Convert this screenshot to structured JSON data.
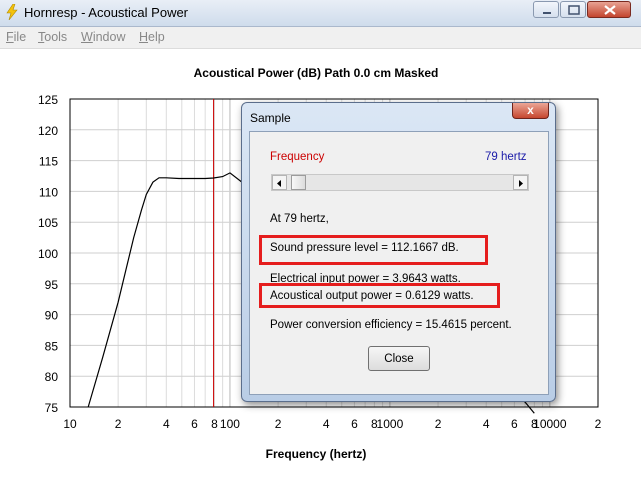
{
  "window": {
    "title": "Hornresp - Acoustical Power"
  },
  "menu": [
    {
      "underline": "F",
      "rest": "ile"
    },
    {
      "underline": "T",
      "rest": "ools"
    },
    {
      "underline": "W",
      "rest": "indow"
    },
    {
      "underline": "H",
      "rest": "elp"
    }
  ],
  "chart_data": {
    "type": "line",
    "title": "Acoustical Power (dB)   Path 0.0 cm   Masked",
    "xlabel": "Frequency (hertz)",
    "ylabel": "",
    "x_scale": "log",
    "xlim": [
      10,
      20000
    ],
    "ylim": [
      75,
      125
    ],
    "y_ticks": [
      75,
      80,
      85,
      90,
      95,
      100,
      105,
      110,
      115,
      120,
      125
    ],
    "x_tick_labels": [
      "10",
      "2",
      "4",
      "6",
      "8",
      "100",
      "2",
      "4",
      "6",
      "8",
      "1000",
      "2",
      "4",
      "6",
      "8",
      "10000",
      "2"
    ],
    "x_tick_values": [
      10,
      20,
      40,
      60,
      80,
      100,
      200,
      400,
      600,
      800,
      1000,
      2000,
      4000,
      6000,
      8000,
      10000,
      20000
    ],
    "grid": true,
    "marker_frequency": 79,
    "series": [
      {
        "color": "#000000",
        "x": [
          13,
          16,
          20,
          25,
          28,
          30,
          33,
          36,
          40,
          48,
          60,
          70,
          79,
          90,
          100,
          7000,
          8000
        ],
        "y": [
          75,
          83,
          92,
          102.5,
          107,
          109.5,
          111.5,
          112.2,
          112.2,
          112.1,
          112.1,
          112.1,
          112.17,
          112.4,
          113,
          75.8,
          74
        ]
      }
    ]
  },
  "dialog": {
    "title": "Sample",
    "close_glyph": "x",
    "frequency_label": "Frequency",
    "frequency_value": "79 hertz",
    "at_text": "At 79 hertz,",
    "spl": "Sound pressure level = 112.1667 dB.",
    "electrical": "Electrical input power = 3.9643 watts.",
    "acoustical": "Acoustical output power = 0.6129 watts.",
    "efficiency": "Power conversion efficiency = 15.4615 percent.",
    "close_button": "Close"
  },
  "colors": {
    "highlight": "#e51d1d",
    "marker": "#cc0000"
  }
}
